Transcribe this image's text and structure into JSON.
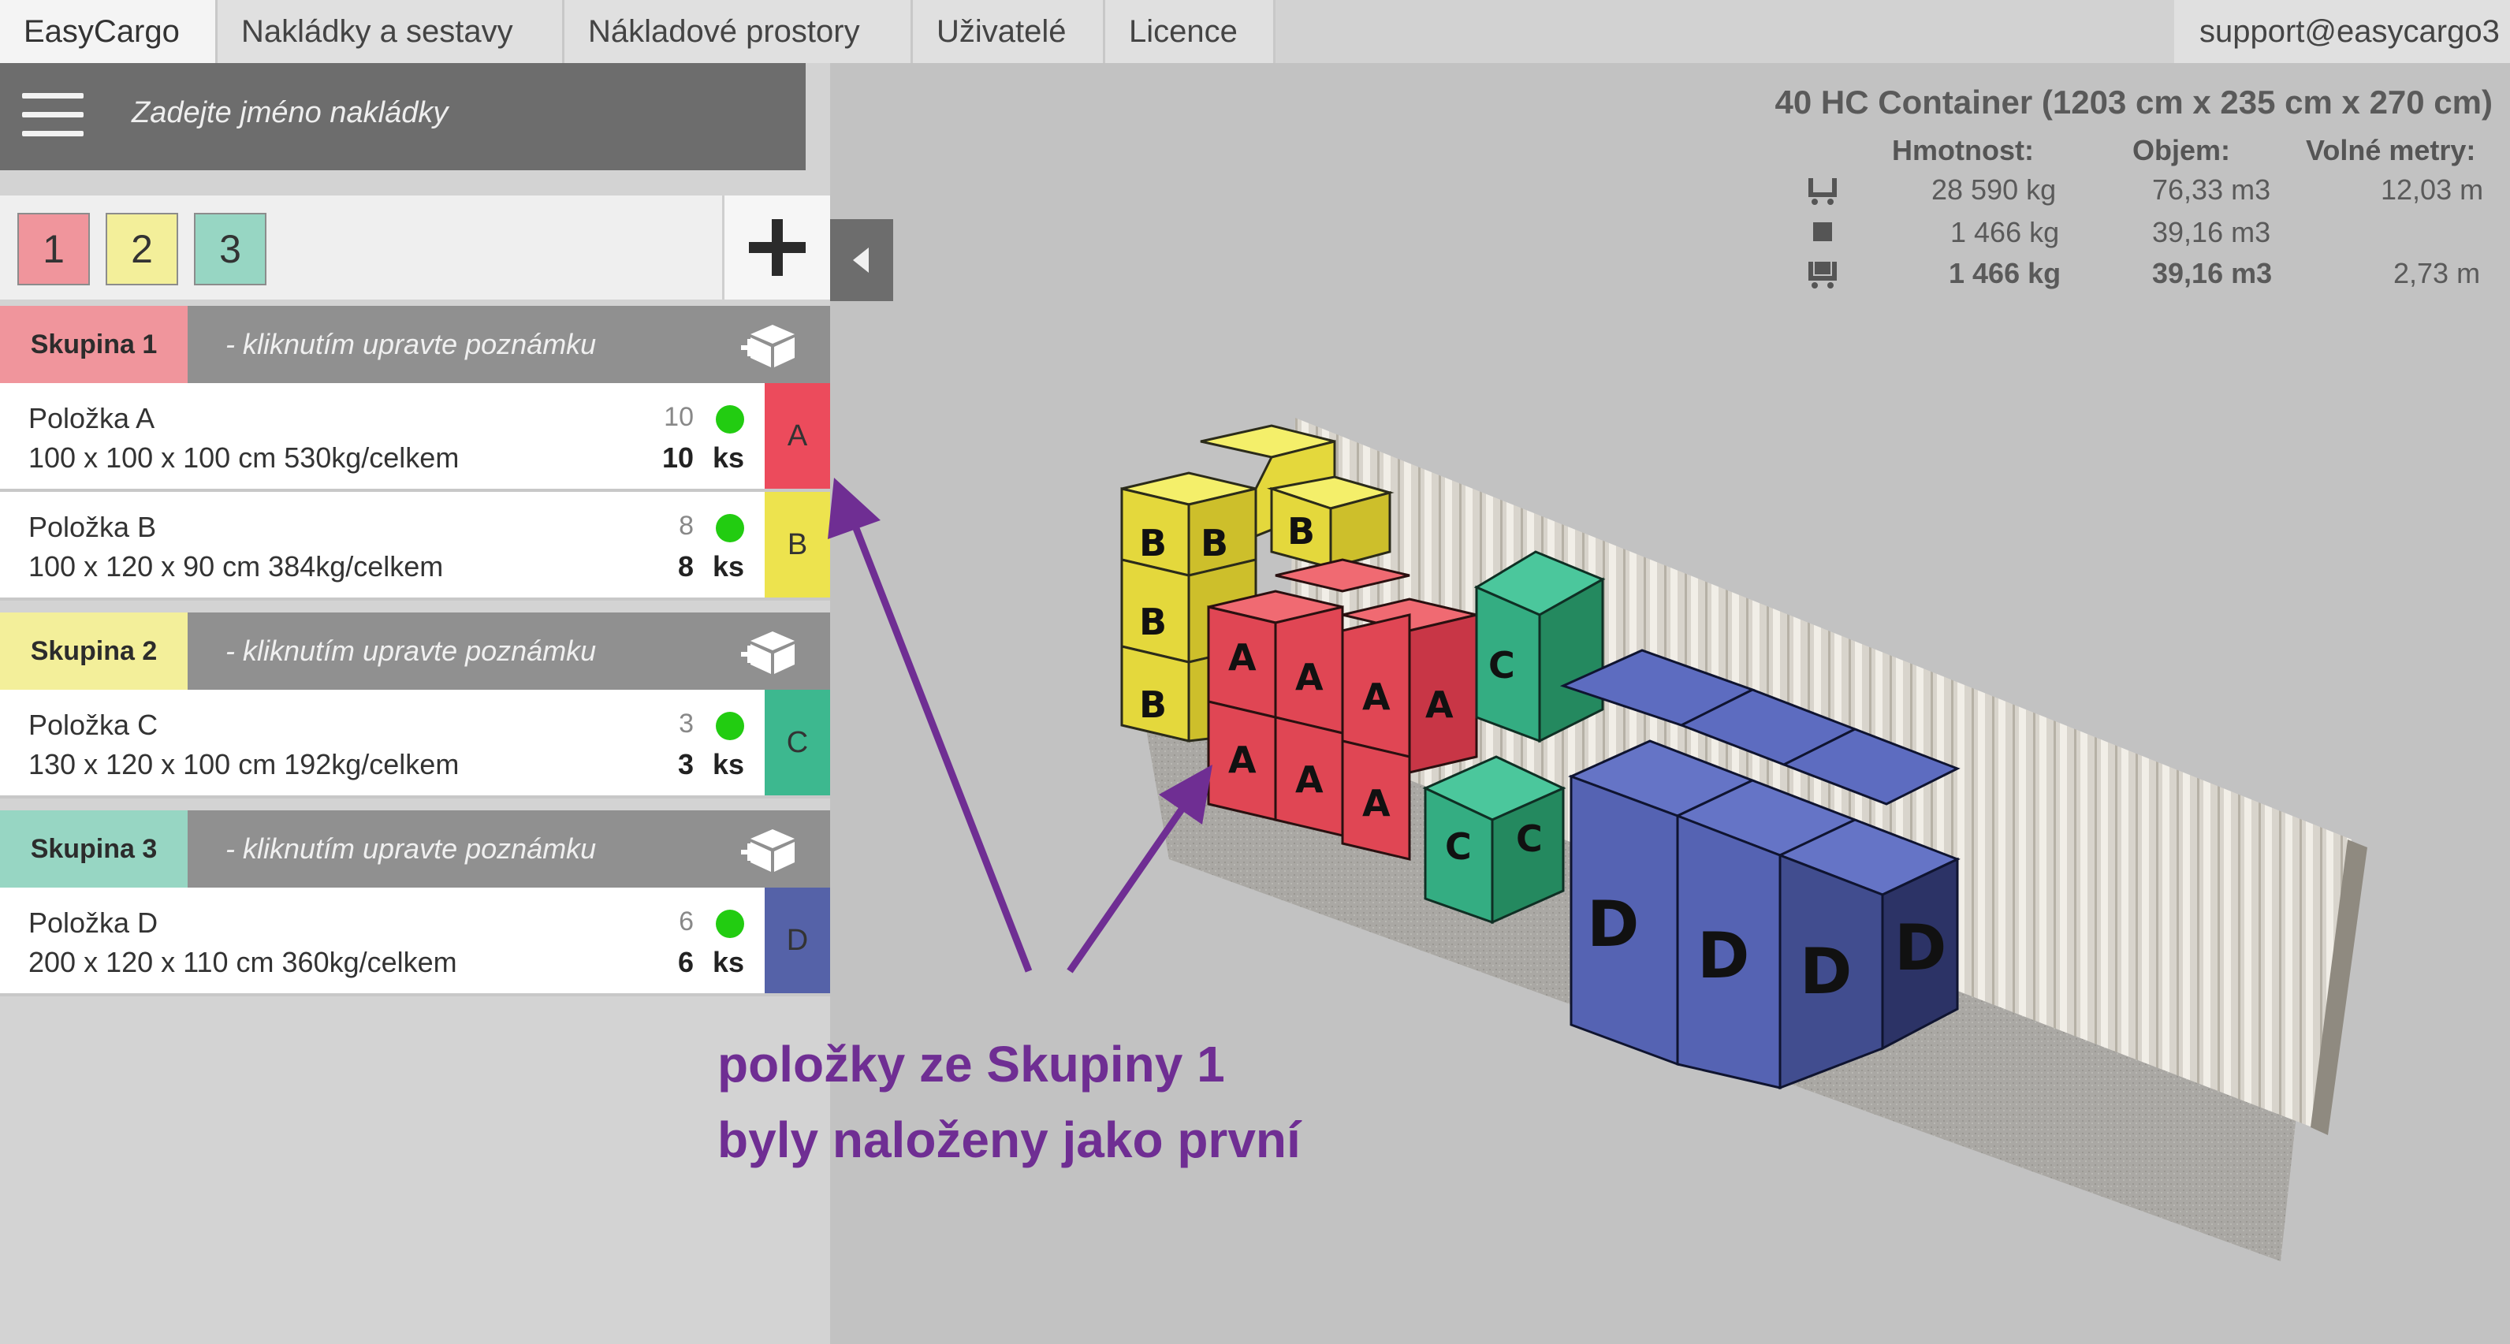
{
  "nav": {
    "tabs": [
      "EasyCargo",
      "Nakládky a sestavy",
      "Nákladové prostory",
      "Uživatelé",
      "Licence"
    ],
    "support": "support@easycargo3"
  },
  "panel": {
    "name_placeholder": "Zadejte jméno nakládky",
    "group_buttons": [
      {
        "label": "1",
        "color": "#f0959c"
      },
      {
        "label": "2",
        "color": "#f3ef9a"
      },
      {
        "label": "3",
        "color": "#97d6c3"
      }
    ]
  },
  "groups": [
    {
      "label": "Skupina 1",
      "color": "#f0959c",
      "note": "- kliknutím upravte poznámku",
      "items": [
        {
          "name": "Položka A",
          "dims": "100 x 100 x 100 cm 530kg/celkem",
          "planned": "10",
          "qty": "10",
          "unit": "ks",
          "letter": "A",
          "color": "#ec4b5c"
        },
        {
          "name": "Položka B",
          "dims": "100 x 120 x 90 cm 384kg/celkem",
          "planned": "8",
          "qty": "8",
          "unit": "ks",
          "letter": "B",
          "color": "#ede34e"
        }
      ]
    },
    {
      "label": "Skupina 2",
      "color": "#f3ef9a",
      "note": "- kliknutím upravte poznámku",
      "items": [
        {
          "name": "Položka C",
          "dims": "130 x 120 x 100 cm 192kg/celkem",
          "planned": "3",
          "qty": "3",
          "unit": "ks",
          "letter": "C",
          "color": "#3db88f"
        }
      ]
    },
    {
      "label": "Skupina 3",
      "color": "#97d6c3",
      "note": "- kliknutím upravte poznámku",
      "items": [
        {
          "name": "Položka D",
          "dims": "200 x 120 x 110 cm 360kg/celkem",
          "planned": "6",
          "qty": "6",
          "unit": "ks",
          "letter": "D",
          "color": "#5562a8"
        }
      ]
    }
  ],
  "container": {
    "title": "40 HC Container (1203 cm x 235 cm x 270 cm)",
    "headers": [
      "Hmotnost:",
      "Objem:",
      "Volné metry:"
    ],
    "rows": [
      {
        "icon": "capacity-icon",
        "weight": "28 590 kg",
        "volume": "76,33 m3",
        "free": "12,03 m"
      },
      {
        "icon": "cargo-icon",
        "weight": "1 466 kg",
        "volume": "39,16 m3",
        "free": ""
      },
      {
        "icon": "loaded-icon",
        "weight": "1 466 kg",
        "volume": "39,16 m3",
        "free": "2,73 m"
      }
    ]
  },
  "annotation": {
    "line1": "položky ze Skupiny 1",
    "line2": "byly naloženy jako první"
  },
  "colors": {
    "accent": "#6f2e93",
    "status_ok": "#22cc11"
  }
}
